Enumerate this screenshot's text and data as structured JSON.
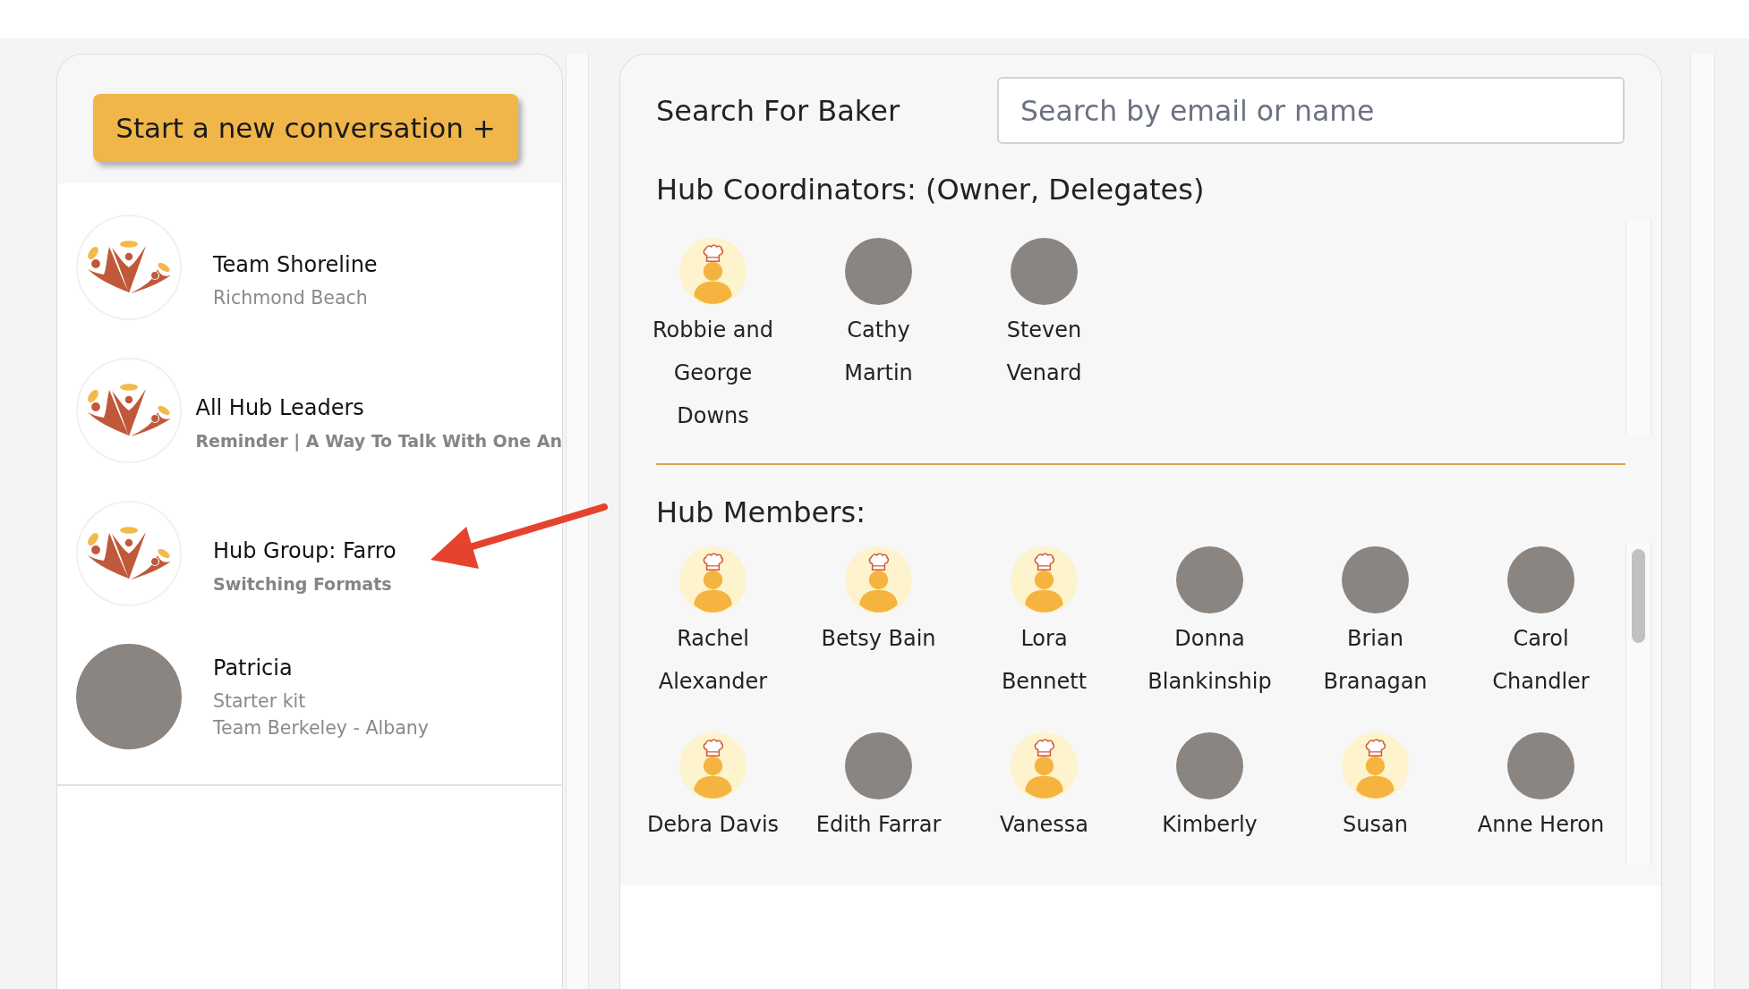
{
  "sidebar": {
    "new_conversation_button": {
      "label": "Start a new conversation +"
    },
    "conversations": [
      {
        "title": "Team Shoreline",
        "lines": [
          "Richmond Beach"
        ],
        "kind": "logo",
        "unread": false
      },
      {
        "title": "All Hub Leaders",
        "lines": [
          "Reminder | A Way To Talk With One An"
        ],
        "kind": "logo",
        "unread": true
      },
      {
        "title": "Hub Group: Farro",
        "lines": [
          "Switching Formats"
        ],
        "kind": "logo",
        "unread": true
      },
      {
        "title": "Patricia",
        "lines": [
          "Starter kit",
          "Team Berkeley - Albany"
        ],
        "kind": "photo",
        "unread": false
      }
    ]
  },
  "baker_search": {
    "label": "Search For Baker",
    "placeholder": "Search by email or name"
  },
  "coordinators": {
    "heading": "Hub Coordinators: (Owner, Delegates)",
    "people": [
      {
        "name": "Robbie and George Downs",
        "kind": "chef"
      },
      {
        "name": "Cathy Martin",
        "kind": "photo"
      },
      {
        "name": "Steven Venard",
        "kind": "photo"
      }
    ]
  },
  "members": {
    "heading": "Hub Members:",
    "people": [
      {
        "name": "Rachel Alexander",
        "kind": "chef"
      },
      {
        "name": "Betsy Bain",
        "kind": "chef"
      },
      {
        "name": "Lora Bennett",
        "kind": "chef"
      },
      {
        "name": "Donna Blankinship",
        "kind": "photo"
      },
      {
        "name": "Brian Branagan",
        "kind": "photo"
      },
      {
        "name": "Carol Chandler",
        "kind": "photo"
      },
      {
        "name": "Debra Davis",
        "kind": "chef"
      },
      {
        "name": "Edith Farrar",
        "kind": "photo"
      },
      {
        "name": "Vanessa",
        "kind": "chef"
      },
      {
        "name": "Kimberly",
        "kind": "photo"
      },
      {
        "name": "Susan",
        "kind": "chef"
      },
      {
        "name": "Anne Heron",
        "kind": "photo"
      }
    ]
  }
}
